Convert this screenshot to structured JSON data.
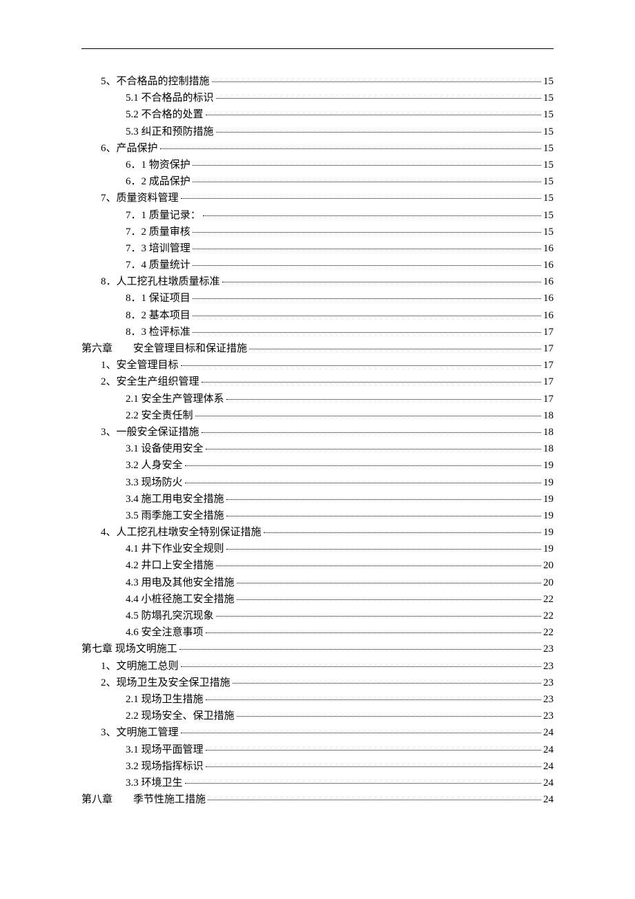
{
  "toc": [
    {
      "level": "lvl-1",
      "label": "5、不合格品的控制措施",
      "page": "15"
    },
    {
      "level": "lvl-2",
      "label": "5.1 不合格品的标识",
      "page": "15"
    },
    {
      "level": "lvl-2",
      "label": "5.2 不合格的处置",
      "page": "15"
    },
    {
      "level": "lvl-2",
      "label": "5.3 纠正和预防措施",
      "page": "15"
    },
    {
      "level": "lvl-1",
      "label": "6、产品保护",
      "page": "15"
    },
    {
      "level": "lvl-2",
      "label": "6．1 物资保护",
      "page": "15"
    },
    {
      "level": "lvl-2",
      "label": "6．2 成品保护",
      "page": "15"
    },
    {
      "level": "lvl-1",
      "label": "7、质量资料管理",
      "page": "15"
    },
    {
      "level": "lvl-2",
      "label": "7．1 质量记录：",
      "page": "15"
    },
    {
      "level": "lvl-2",
      "label": "7．2 质量审核",
      "page": "15"
    },
    {
      "level": "lvl-2",
      "label": "7．3 培训管理",
      "page": "16"
    },
    {
      "level": "lvl-2",
      "label": "7．4 质量统计",
      "page": "16"
    },
    {
      "level": "lvl-1",
      "label": "8．人工挖孔柱墩质量标准",
      "page": "16"
    },
    {
      "level": "lvl-2",
      "label": "8．1 保证项目",
      "page": "16"
    },
    {
      "level": "lvl-2",
      "label": "8．2 基本项目",
      "page": "16"
    },
    {
      "level": "lvl-2",
      "label": "8．3 检评标准",
      "page": "17"
    },
    {
      "level": "lvl-chapter",
      "label": "第六章　　安全管理目标和保证措施",
      "page": "17"
    },
    {
      "level": "lvl-1",
      "label": "1、安全管理目标",
      "page": "17"
    },
    {
      "level": "lvl-1",
      "label": "2、安全生产组织管理",
      "page": "17"
    },
    {
      "level": "lvl-2",
      "label": "2.1 安全生产管理体系",
      "page": "17"
    },
    {
      "level": "lvl-2",
      "label": "2.2 安全责任制",
      "page": "18"
    },
    {
      "level": "lvl-1",
      "label": "3、一般安全保证措施",
      "page": "18"
    },
    {
      "level": "lvl-2",
      "label": "3.1 设备使用安全",
      "page": "18"
    },
    {
      "level": "lvl-2",
      "label": "3.2 人身安全",
      "page": "19"
    },
    {
      "level": "lvl-2",
      "label": "3.3 现场防火",
      "page": "19"
    },
    {
      "level": "lvl-2",
      "label": "3.4 施工用电安全措施",
      "page": "19"
    },
    {
      "level": "lvl-2",
      "label": "3.5 雨季施工安全措施",
      "page": "19"
    },
    {
      "level": "lvl-1",
      "label": "4、人工挖孔柱墩安全特别保证措施",
      "page": "19"
    },
    {
      "level": "lvl-2",
      "label": "4.1 井下作业安全规则",
      "page": "19"
    },
    {
      "level": "lvl-2",
      "label": "4.2 井口上安全措施",
      "page": "20"
    },
    {
      "level": "lvl-2",
      "label": "4.3 用电及其他安全措施",
      "page": "20"
    },
    {
      "level": "lvl-2",
      "label": "4.4 小桩径施工安全措施",
      "page": "22"
    },
    {
      "level": "lvl-2",
      "label": "4.5 防塌孔突沉现象",
      "page": "22"
    },
    {
      "level": "lvl-2",
      "label": "4.6 安全注意事项",
      "page": "22"
    },
    {
      "level": "lvl-chapter",
      "label": "第七章 现场文明施工",
      "page": "23"
    },
    {
      "level": "lvl-1",
      "label": "1、文明施工总则",
      "page": "23"
    },
    {
      "level": "lvl-1",
      "label": "2、现场卫生及安全保卫措施",
      "page": "23"
    },
    {
      "level": "lvl-2",
      "label": "2.1  现场卫生措施",
      "page": "23"
    },
    {
      "level": "lvl-2",
      "label": "2.2  现场安全、保卫措施",
      "page": "23"
    },
    {
      "level": "lvl-1",
      "label": "3、文明施工管理",
      "page": "24"
    },
    {
      "level": "lvl-2",
      "label": "3.1  现场平面管理",
      "page": "24"
    },
    {
      "level": "lvl-2",
      "label": "3.2  现场指挥标识",
      "page": "24"
    },
    {
      "level": "lvl-2",
      "label": "3.3  环境卫生",
      "page": "24"
    },
    {
      "level": "lvl-chapter",
      "label": "第八章　　季节性施工措施",
      "page": "24"
    }
  ]
}
